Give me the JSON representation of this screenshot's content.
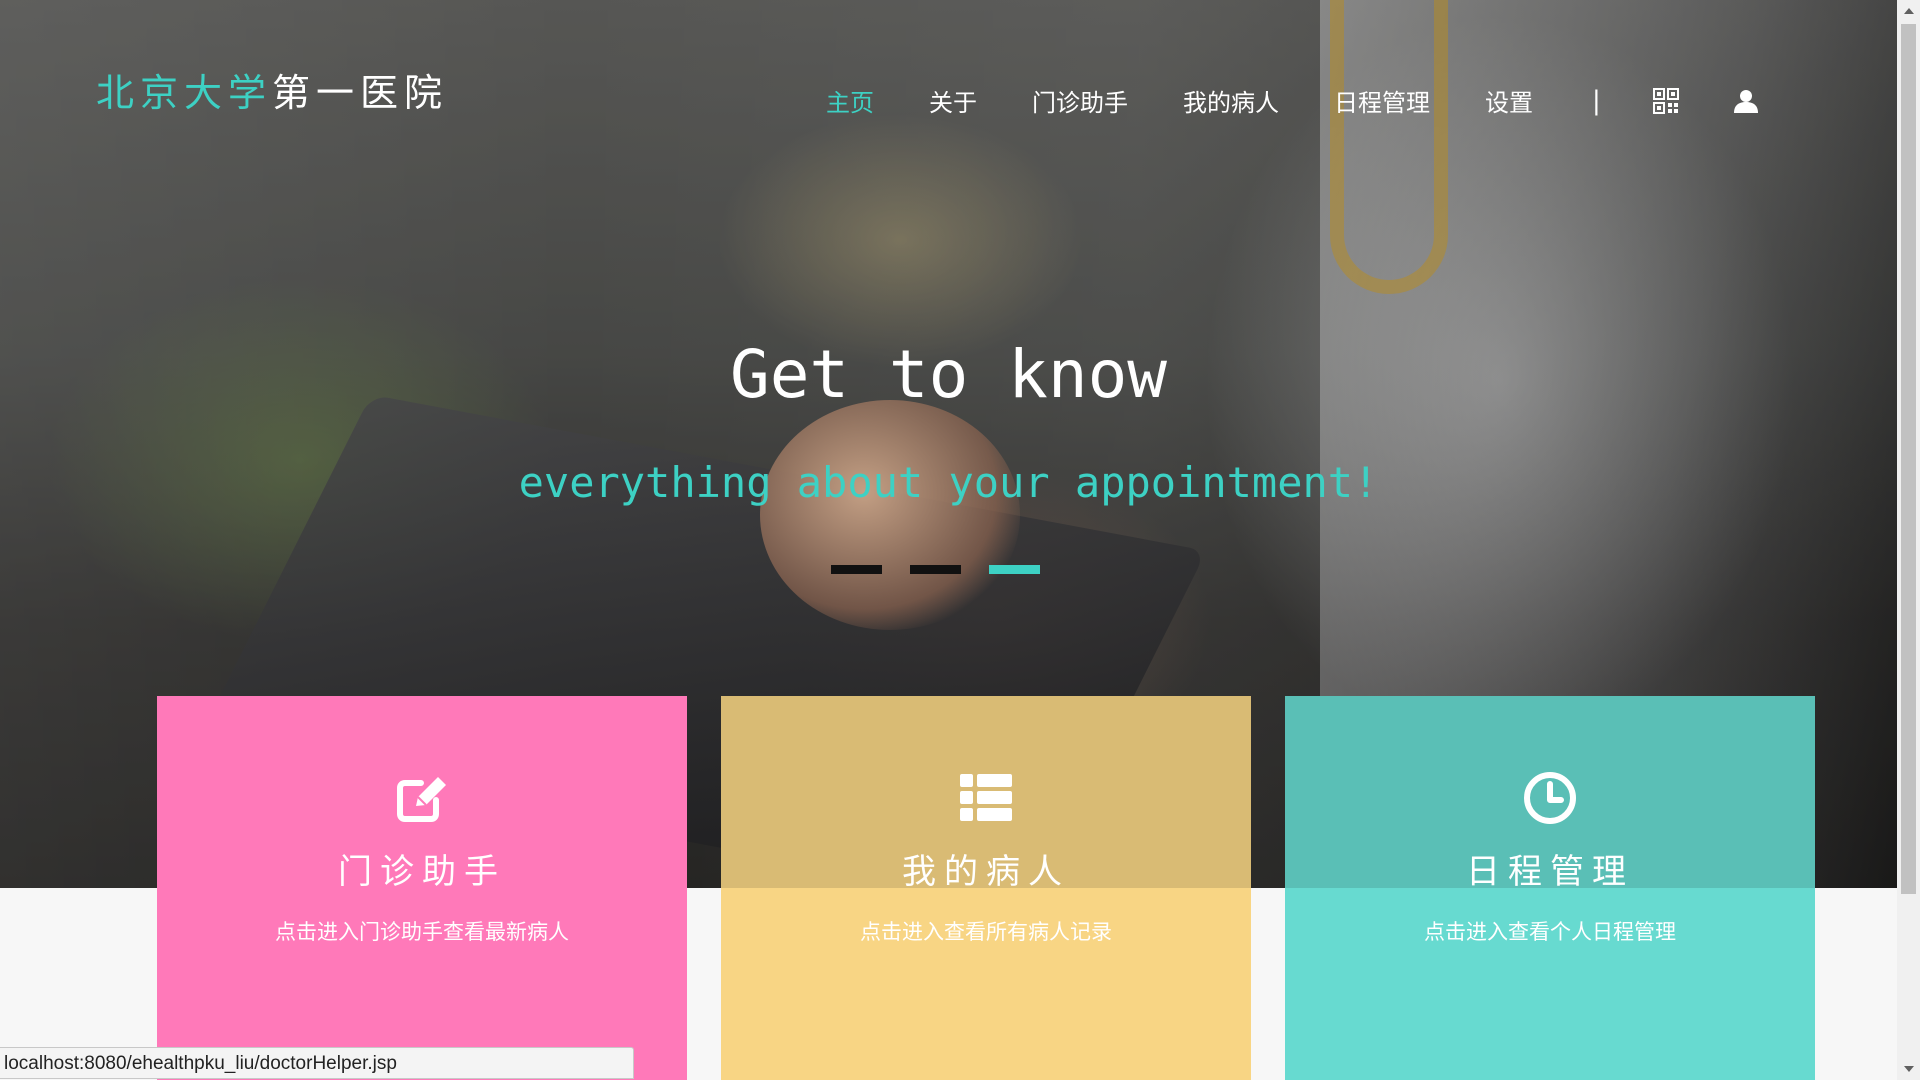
{
  "brand": {
    "accent_text": "北京大学",
    "plain_text": "第一医院",
    "accent_color": "#3dd1c4"
  },
  "nav": {
    "items": [
      {
        "label": "主页",
        "active": true
      },
      {
        "label": "关于",
        "active": false
      },
      {
        "label": "门诊助手",
        "active": false
      },
      {
        "label": "我的病人",
        "active": false
      },
      {
        "label": "日程管理",
        "active": false
      },
      {
        "label": "设置",
        "active": false
      }
    ],
    "separator": "|",
    "icons": [
      "qrcode-icon",
      "user-icon"
    ]
  },
  "hero": {
    "title": "Get to know",
    "subtitle": "everything about your appointment!",
    "carousel": {
      "count": 3,
      "active_index": 2
    }
  },
  "cards": [
    {
      "icon": "edit-icon",
      "title": "门诊助手",
      "description": "点击进入门诊助手查看最新病人",
      "color": "#ff79b9"
    },
    {
      "icon": "list-icon",
      "title": "我的病人",
      "description": "点击进入查看所有病人记录",
      "color": "#f8d584"
    },
    {
      "icon": "clock-icon",
      "title": "日程管理",
      "description": "点击进入查看个人日程管理",
      "color": "#67dad0"
    }
  ],
  "status_bar": {
    "url": "localhost:8080/ehealthpku_liu/doctorHelper.jsp"
  }
}
